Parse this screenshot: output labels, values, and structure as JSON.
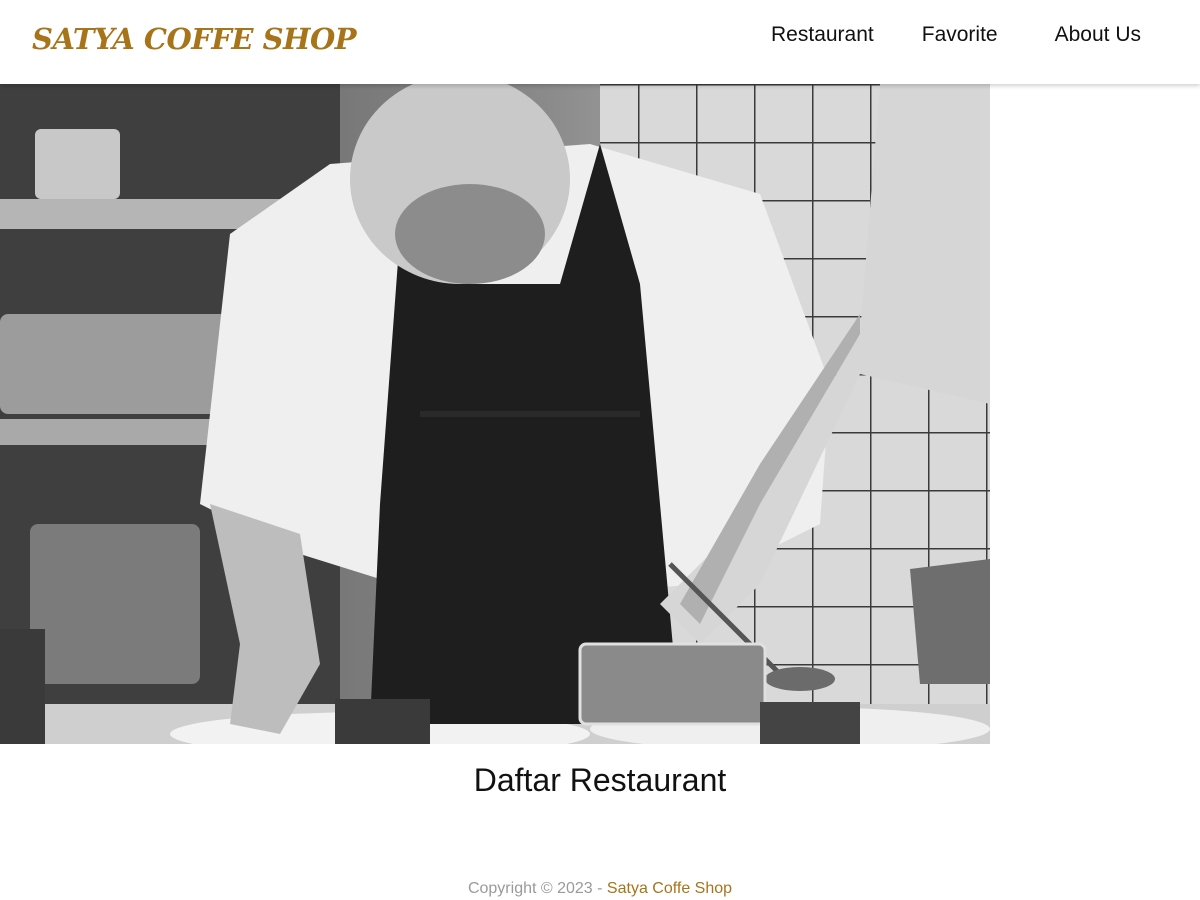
{
  "header": {
    "brand": "SATYA COFFE SHOP",
    "nav": [
      {
        "label": "Restaurant"
      },
      {
        "label": "Favorite"
      },
      {
        "label": "About Us"
      }
    ]
  },
  "hero": {
    "image_icon": "chef-photo"
  },
  "main": {
    "section_title": "Daftar Restaurant"
  },
  "footer": {
    "copyright_prefix": "Copyright © 2023 - ",
    "brand_link": "Satya Coffe Shop"
  },
  "colors": {
    "brand": "#a8741a",
    "nav_text": "#111111",
    "footer_text": "#9a9a9a"
  }
}
